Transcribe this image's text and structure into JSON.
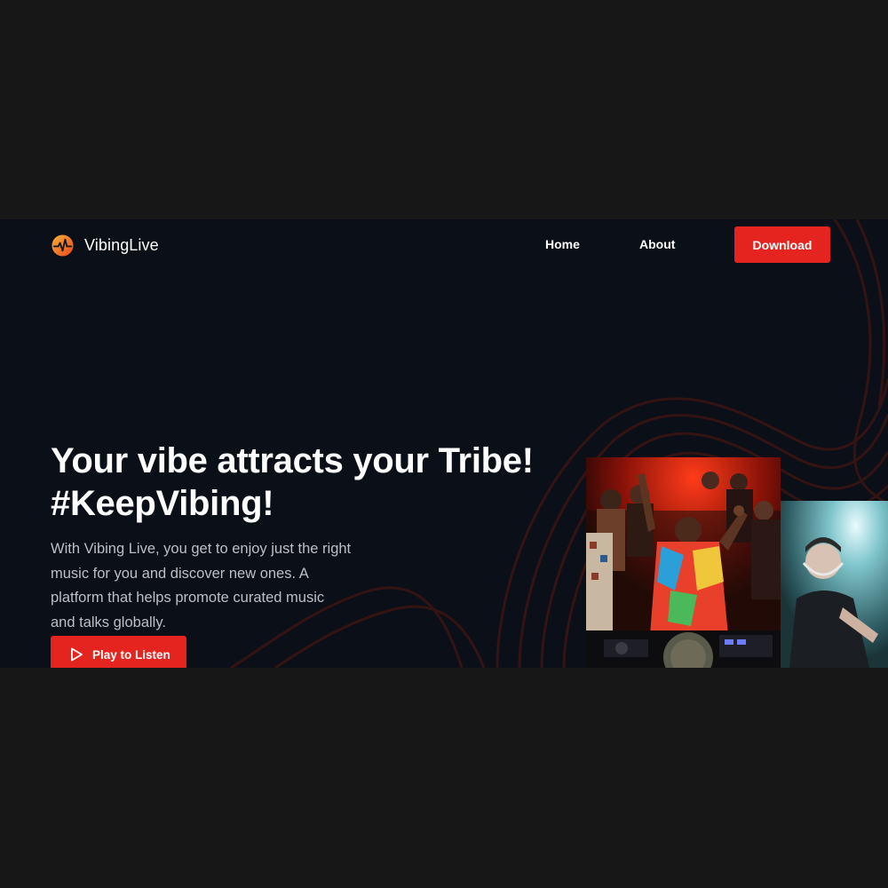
{
  "header": {
    "logo_text": "VibingLive",
    "nav": [
      {
        "label": "Home"
      },
      {
        "label": "About"
      }
    ],
    "download_label": "Download"
  },
  "hero": {
    "title_line1": "Your vibe attracts your Tribe!",
    "title_line2": "#KeepVibing!",
    "description": "With Vibing Live, you get to enjoy just the right music for you and discover new ones. A platform that helps promote curated music and talks globally.",
    "play_label": "Play to Listen"
  },
  "icons": {
    "logo": "vibinglive-logo-icon",
    "play": "play-icon"
  },
  "colors": {
    "page_background": "#171717",
    "frame_background": "#0b0f17",
    "accent": "#e5241f",
    "logo_orange": "#f7941d",
    "text_primary": "#ffffff",
    "text_secondary": "#bdbfc4"
  }
}
